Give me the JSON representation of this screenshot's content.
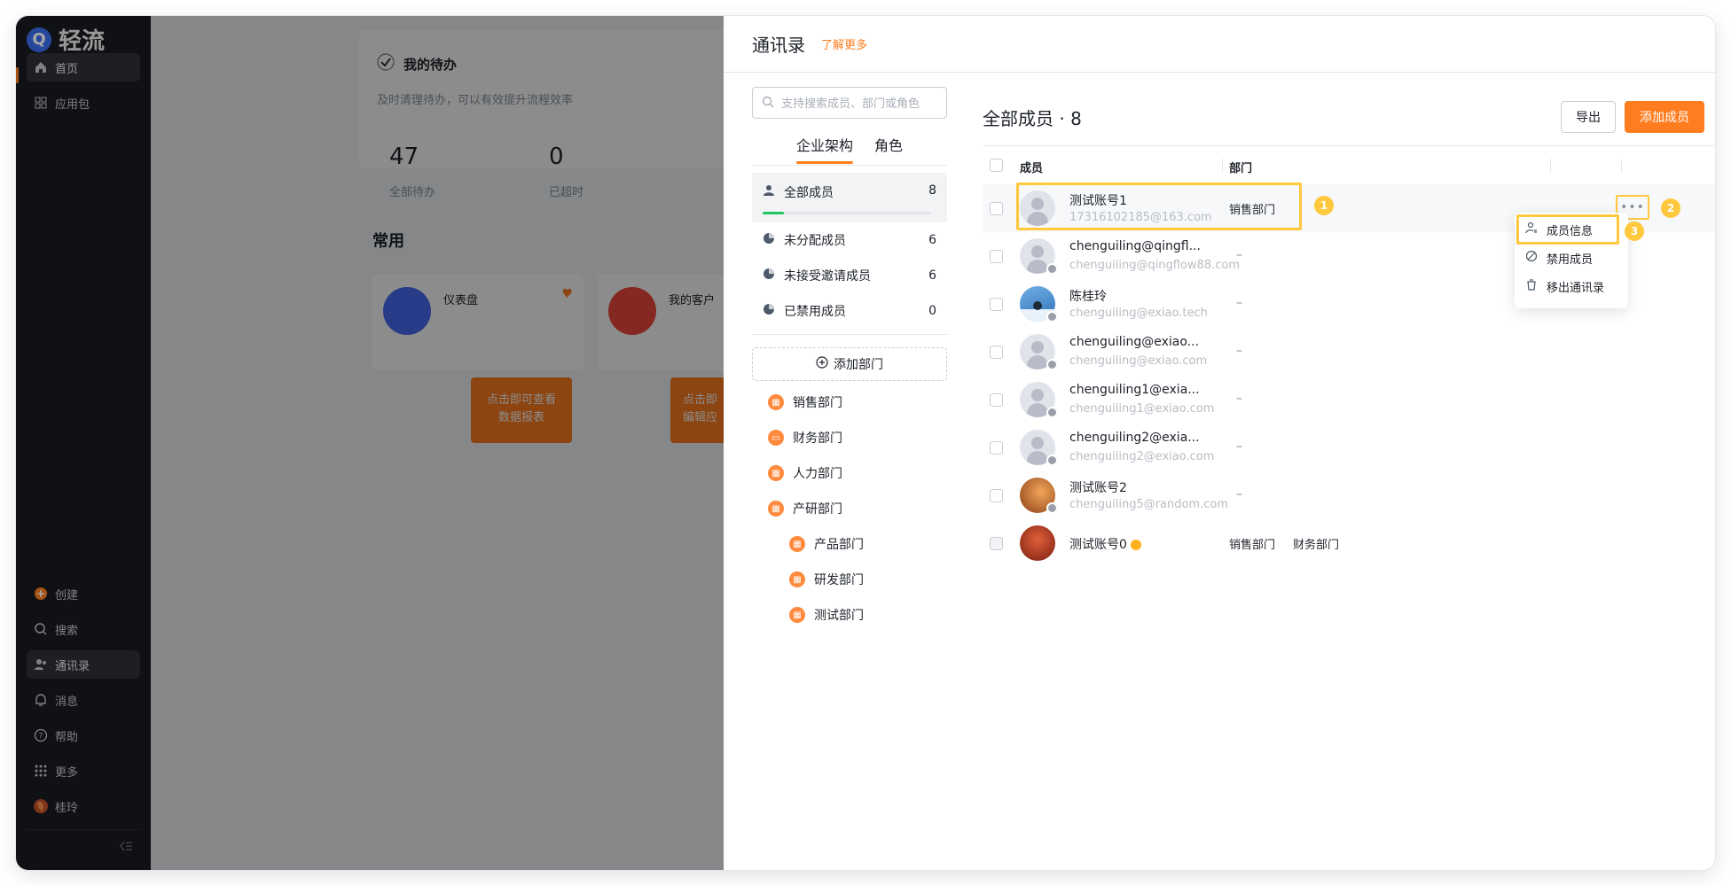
{
  "app": {
    "logo_letter": "Q",
    "name": "轻流"
  },
  "nav": {
    "top_items": [
      {
        "label": "首页",
        "icon": "home-icon"
      },
      {
        "label": "应用包",
        "icon": "grid-icon"
      }
    ],
    "bottom_items": [
      {
        "label": "创建",
        "icon": "plus-circle-icon"
      },
      {
        "label": "搜索",
        "icon": "search-icon"
      },
      {
        "label": "通讯录",
        "icon": "contacts-icon"
      },
      {
        "label": "消息",
        "icon": "bell-icon"
      },
      {
        "label": "帮助",
        "icon": "help-icon"
      },
      {
        "label": "更多",
        "icon": "dots-grid-icon"
      },
      {
        "label": "桂玲",
        "icon": "user-avatar"
      }
    ]
  },
  "dashboard": {
    "todo_title": "我的待办",
    "todo_sub": "及时清理待办，可以有效提升流程效率",
    "stats": [
      {
        "value": "47",
        "label": "全部待办"
      },
      {
        "value": "0",
        "label": "已超时"
      }
    ],
    "common_title": "常用",
    "apps": [
      {
        "name": "仪表盘",
        "tip_line1": "点击即可查看",
        "tip_line2": "数据报表"
      },
      {
        "name": "我的客户",
        "tip_line1": "点击即",
        "tip_line2": "编辑应"
      }
    ]
  },
  "drawer": {
    "title": "通讯录",
    "learn_more": "了解更多",
    "search_placeholder": "支持搜索成员、部门或角色",
    "tabs": [
      "企业架构",
      "角色"
    ],
    "groups": [
      {
        "label": "全部成员",
        "count": "8"
      },
      {
        "label": "未分配成员",
        "count": "6"
      },
      {
        "label": "未接受邀请成员",
        "count": "6"
      },
      {
        "label": "已禁用成员",
        "count": "0"
      }
    ],
    "all_members_progress": 0.125,
    "add_department": "添加部门",
    "departments": [
      {
        "label": "销售部门",
        "level": 0
      },
      {
        "label": "财务部门",
        "level": 0
      },
      {
        "label": "人力部门",
        "level": 0
      },
      {
        "label": "产研部门",
        "level": 0
      },
      {
        "label": "产品部门",
        "level": 1
      },
      {
        "label": "研发部门",
        "level": 1
      },
      {
        "label": "测试部门",
        "level": 1
      }
    ],
    "members_title": "全部成员 · 8",
    "export_label": "导出",
    "add_member_label": "添加成员",
    "columns": {
      "member": "成员",
      "department": "部门"
    },
    "members": [
      {
        "name": "测试账号1",
        "email": "17316102185@163.com",
        "dept": "销售部门",
        "dept2": "",
        "avatar": "default"
      },
      {
        "name": "chenguiling@qingfl...",
        "email": "chenguiling@qingflow88.com",
        "dept": "–",
        "dept2": "",
        "avatar": "default"
      },
      {
        "name": "陈桂玲",
        "email": "chenguiling@exiao.tech",
        "dept": "–",
        "dept2": "",
        "avatar": "photo-blue"
      },
      {
        "name": "chenguiling@exiao...",
        "email": "chenguiling@exiao.com",
        "dept": "–",
        "dept2": "",
        "avatar": "default"
      },
      {
        "name": "chenguiling1@exia...",
        "email": "chenguiling1@exiao.com",
        "dept": "–",
        "dept2": "",
        "avatar": "default"
      },
      {
        "name": "chenguiling2@exia...",
        "email": "chenguiling2@exiao.com",
        "dept": "–",
        "dept2": "",
        "avatar": "default"
      },
      {
        "name": "测试账号2",
        "email": "chenguiling5@random.com",
        "dept": "–",
        "dept2": "",
        "avatar": "photo-orange"
      },
      {
        "name": "测试账号0",
        "email": "",
        "dept": "销售部门",
        "dept2": "财务部门",
        "avatar": "photo-red"
      }
    ],
    "more_label": "•••",
    "context_menu": [
      {
        "label": "成员信息",
        "icon": "user-info-icon"
      },
      {
        "label": "禁用成员",
        "icon": "ban-icon"
      },
      {
        "label": "移出通讯录",
        "icon": "trash-icon"
      }
    ],
    "callouts": [
      "1",
      "2",
      "3"
    ]
  }
}
